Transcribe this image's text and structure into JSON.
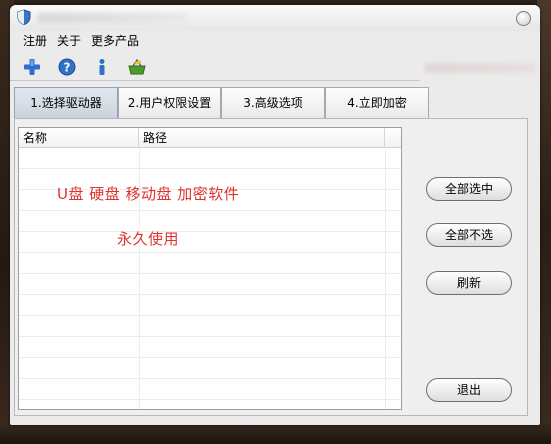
{
  "window": {
    "menu": [
      "注册",
      "关于",
      "更多产品"
    ]
  },
  "toolbar": {
    "icons": [
      "plus-icon",
      "help-icon",
      "info-icon",
      "basket-icon"
    ]
  },
  "tabs": [
    {
      "label": "1.选择驱动器",
      "active": true
    },
    {
      "label": "2.用户权限设置",
      "active": false
    },
    {
      "label": "3.高级选项",
      "active": false
    },
    {
      "label": "4.立即加密",
      "active": false
    }
  ],
  "list": {
    "columns": [
      "名称",
      "路径"
    ],
    "rows": []
  },
  "overlay": {
    "line1": "U盘  硬盘 移动盘   加密软件",
    "line2": "永久使用"
  },
  "buttons": {
    "select_all": "全部选中",
    "deselect_all": "全部不选",
    "refresh": "刷新",
    "exit": "退出"
  },
  "colors": {
    "accent_red": "#e0312f",
    "tab_active": "#c9d3dd",
    "window_bg": "#ebebeb"
  }
}
